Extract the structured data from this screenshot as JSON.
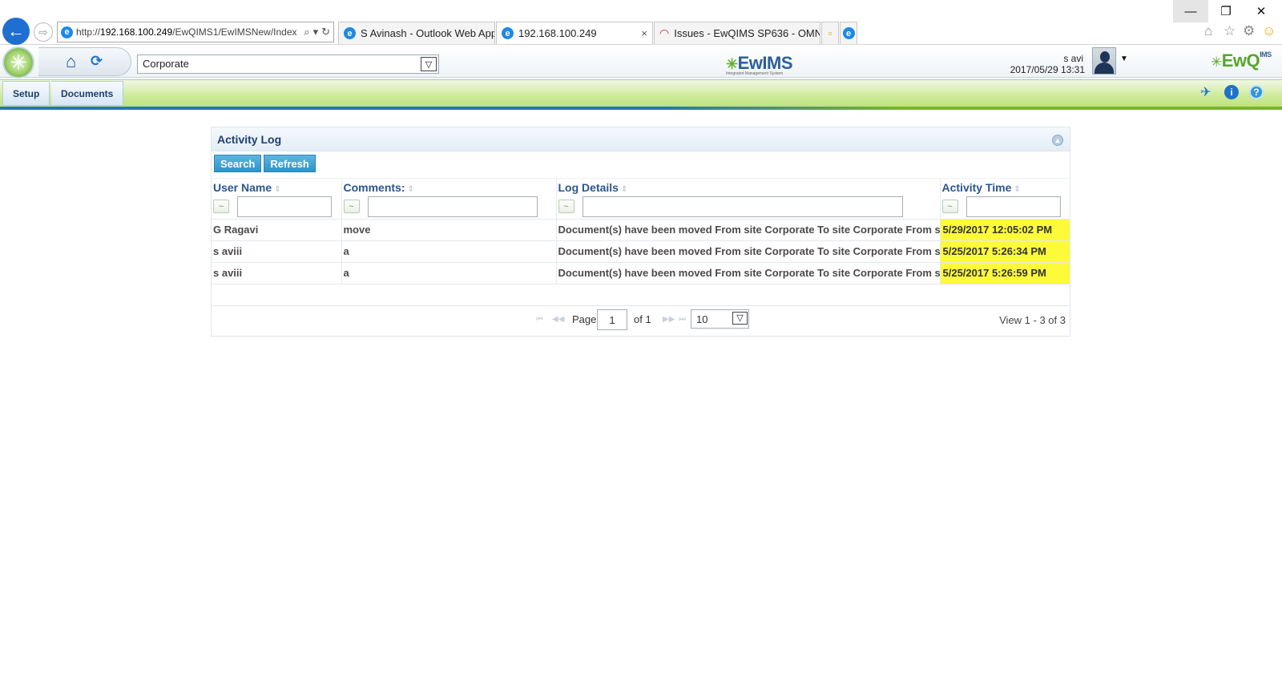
{
  "browser": {
    "url_prefix": "http://",
    "url_host": "192.168.100.249",
    "url_path": "/EwQIMS1/EwIMSNew/Index",
    "tabs": [
      {
        "label": "S Avinash - Outlook Web App"
      },
      {
        "label": "192.168.100.249"
      },
      {
        "label": "Issues - EwQIMS SP636 - OMN..."
      }
    ],
    "tab_close": "×",
    "win_min": "—",
    "win_restore": "❐",
    "win_close": "✕"
  },
  "header": {
    "site_value": "Corporate",
    "brand_center": "EwIMS",
    "brand_tagline": "Integrated Management System",
    "brand_right": "EwQ",
    "brand_right_sup": "IMS",
    "user_name": "s avi",
    "user_datetime": "2017/05/29 13:31"
  },
  "menu": {
    "setup": "Setup",
    "documents": "Documents"
  },
  "panel": {
    "title": "Activity Log",
    "search_label": "Search",
    "refresh_label": "Refresh",
    "columns": [
      "User Name",
      "Comments:",
      "Log Details",
      "Activity Time"
    ],
    "rows": [
      {
        "user": "G Ragavi",
        "comment": "move",
        "details": "Document(s) have been moved From site Corporate To site Corporate From site le",
        "time": "5/29/2017 12:05:02 PM"
      },
      {
        "user": "s aviii",
        "comment": "a",
        "details": "Document(s) have been moved From site Corporate To site Corporate From site le",
        "time": "5/25/2017 5:26:34 PM"
      },
      {
        "user": "s aviii",
        "comment": "a",
        "details": "Document(s) have been moved From site Corporate To site Corporate From site le",
        "time": "5/25/2017 5:26:59 PM"
      }
    ]
  },
  "pager": {
    "page_label": "Page",
    "page_value": "1",
    "of_label": "of 1",
    "rows_per_page": "10",
    "view_info": "View 1 - 3 of 3"
  },
  "colors": {
    "accent": "#2b558c",
    "highlight": "#fdfa3a",
    "menu_green": "#cdea99",
    "button_blue": "#2d94c8"
  }
}
